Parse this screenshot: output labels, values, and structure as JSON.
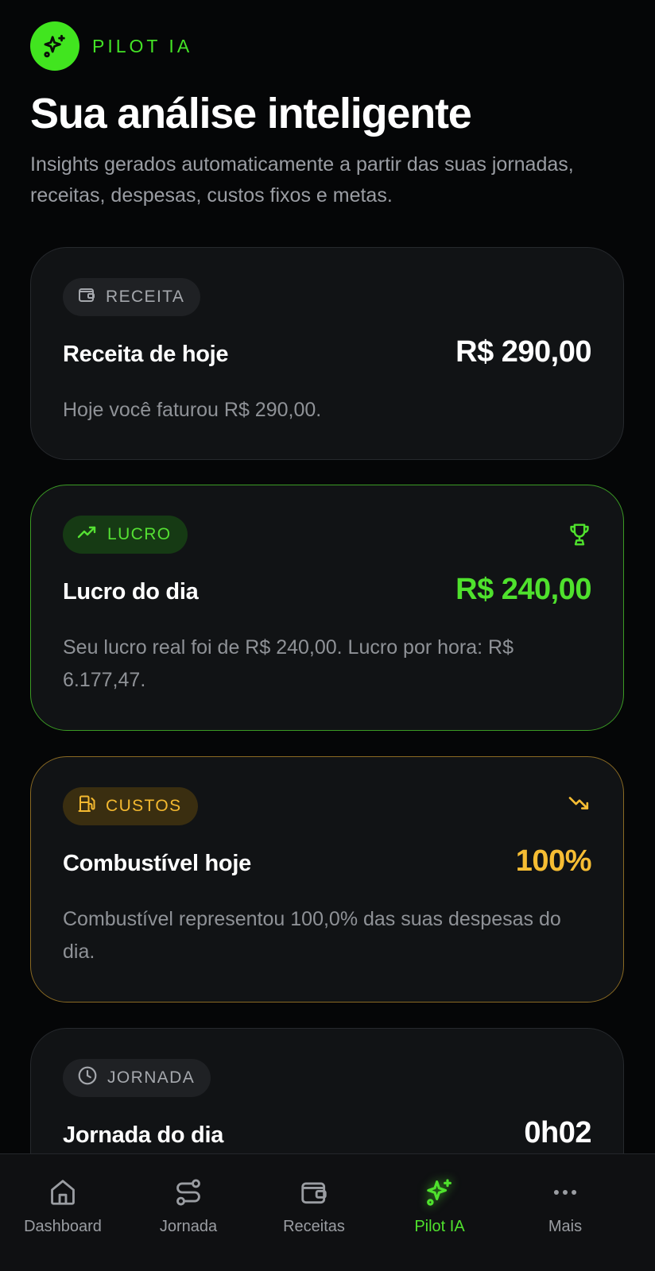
{
  "brand": {
    "label": "PILOT IA",
    "icon": "sparkles-icon"
  },
  "header": {
    "title": "Sua análise inteligente",
    "subtitle": "Insights gerados automaticamente a partir das suas jornadas, receitas, despesas, custos fixos e metas."
  },
  "cards": [
    {
      "tag": "RECEITA",
      "tag_icon": "wallet-icon",
      "title": "Receita de hoje",
      "value": "R$ 290,00",
      "description": "Hoje você faturou R$ 290,00."
    },
    {
      "tag": "LUCRO",
      "tag_icon": "trending-up-icon",
      "corner_icon": "trophy-icon",
      "title": "Lucro do dia",
      "value": "R$ 240,00",
      "description": "Seu lucro real foi de R$ 240,00. Lucro por hora: R$ 6.177,47."
    },
    {
      "tag": "CUSTOS",
      "tag_icon": "fuel-icon",
      "corner_icon": "trending-down-icon",
      "title": "Combustível hoje",
      "value": "100%",
      "description": "Combustível representou 100,0% das suas despesas do dia."
    },
    {
      "tag": "JORNADA",
      "tag_icon": "clock-icon",
      "title": "Jornada do dia",
      "value": "0h02"
    }
  ],
  "nav": {
    "items": [
      {
        "label": "Dashboard",
        "icon": "home-icon",
        "active": false
      },
      {
        "label": "Jornada",
        "icon": "route-icon",
        "active": false
      },
      {
        "label": "Receitas",
        "icon": "wallet-icon",
        "active": false
      },
      {
        "label": "Pilot IA",
        "icon": "sparkles-icon",
        "active": true
      },
      {
        "label": "Mais",
        "icon": "more-icon",
        "active": false
      }
    ]
  },
  "colors": {
    "background": "#050607",
    "accent_green": "#4fe12d",
    "accent_amber": "#f6bd33",
    "card_bg": "#111315"
  }
}
